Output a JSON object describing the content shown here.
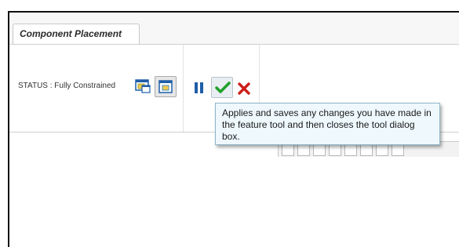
{
  "tabs": [
    {
      "label": "Component Placement",
      "active": true
    }
  ],
  "status": {
    "text": "STATUS : Fully Constrained"
  },
  "toolbar": {
    "icons": [
      "display-in-separate-window-icon",
      "display-in-assembly-window-icon",
      "pause-icon",
      "ok-checkmark-icon",
      "cancel-x-icon"
    ]
  },
  "tooltip": {
    "text": "Applies and saves any changes you have made in the feature tool and then closes the tool dialog box."
  },
  "colors": {
    "accent_blue": "#1f5ea8",
    "ok_green": "#22a02a",
    "cancel_red": "#cc1f1a",
    "tooltip_bg": "#eef8fd"
  }
}
